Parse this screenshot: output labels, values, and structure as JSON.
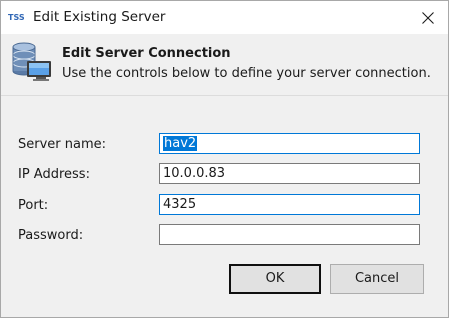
{
  "window": {
    "app_icon_text": "TSS",
    "title": "Edit Existing Server"
  },
  "header": {
    "title": "Edit Server Connection",
    "description": "Use the controls below to define your server connection."
  },
  "form": {
    "server_name": {
      "label": "Server name:",
      "value": "hav2"
    },
    "ip_address": {
      "label": "IP Address:",
      "value": "10.0.0.83"
    },
    "port": {
      "label": "Port:",
      "value": "4325"
    },
    "password": {
      "label": "Password:",
      "value": ""
    }
  },
  "buttons": {
    "ok_label": "OK",
    "cancel_label": "Cancel"
  },
  "colors": {
    "accent": "#0078d7",
    "app_icon": "#2f66b5"
  },
  "icons": {
    "app": "tss-app-icon",
    "header": "server-connection-icon",
    "close": "close-icon"
  }
}
